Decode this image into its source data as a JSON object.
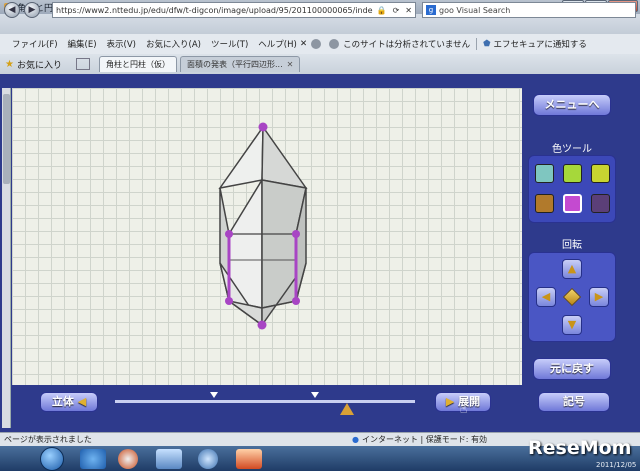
{
  "window": {
    "title": "角柱と円柱（仮） - Windows Internet Explorer",
    "min": "–",
    "max": "□",
    "close": "✕"
  },
  "address": {
    "back": "◀",
    "forward": "▶",
    "url": "https://www2.nttedu.jp/edu/dfw/t-digcon/image/upload/95/201100000065/inde",
    "search_engine": "goo Visual Search"
  },
  "menubar": {
    "items": [
      "ファイル(F)",
      "編集(E)",
      "表示(V)",
      "お気に入り(A)",
      "ツール(T)",
      "ヘルプ(H)"
    ],
    "security_warning": "このサイトは分析されていません",
    "security_notify": "エフセキュアに通知する"
  },
  "favorites": {
    "label": "お気に入り",
    "tabs": [
      {
        "label": "角柱と円柱（仮）",
        "active": true
      },
      {
        "label": "面積の発表（平行四辺形...",
        "active": false
      }
    ]
  },
  "panel": {
    "menu_button": "メニューへ",
    "color_tool_label": "色ツール",
    "colors": [
      "#7fc6c0",
      "#a6d83a",
      "#c8d431",
      "#b17a2c",
      "#c44ad0",
      "#5b3f78"
    ],
    "rotation_label": "回転",
    "rotation": {
      "up": "▲",
      "down": "▼",
      "left": "◀",
      "right": "▶"
    },
    "reset_button": "元に戻す"
  },
  "bottom": {
    "solid_button": "立体",
    "unfold_button": "展開",
    "symbol_button": "記号",
    "slider_position": 0.75
  },
  "status": {
    "left": "ページが表示されました",
    "zone": "インターネット | 保護モード: 有効"
  },
  "taskbar": {
    "date": "2011/12/05"
  },
  "watermark": "ReseMom"
}
